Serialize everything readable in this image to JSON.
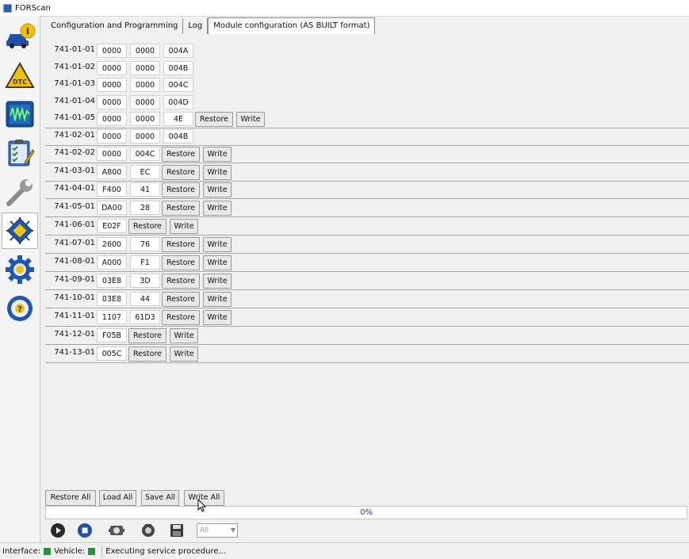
{
  "window": {
    "title": "FORScan"
  },
  "sidebar": {
    "items": [
      {
        "id": "vehicle-info",
        "icon": "car-info-icon"
      },
      {
        "id": "dtc",
        "icon": "dtc-warning-icon"
      },
      {
        "id": "oscilloscope",
        "icon": "oscilloscope-icon"
      },
      {
        "id": "tests",
        "icon": "checklist-icon"
      },
      {
        "id": "service",
        "icon": "wrench-icon"
      },
      {
        "id": "configuration",
        "icon": "chip-icon",
        "active": true
      },
      {
        "id": "settings",
        "icon": "gear-icon"
      },
      {
        "id": "help",
        "icon": "steering-help-icon"
      }
    ]
  },
  "tabs": [
    {
      "label": "Configuration and Programming"
    },
    {
      "label": "Log"
    },
    {
      "label": "Module configuration (AS BUILT format)",
      "active": true
    }
  ],
  "config": {
    "restore_label": "Restore",
    "write_label": "Write",
    "rows": [
      {
        "addr": "741-01-01",
        "cells": [
          "0000",
          "0000",
          "004A"
        ]
      },
      {
        "addr": "741-01-02",
        "cells": [
          "0000",
          "0000",
          "004B"
        ]
      },
      {
        "addr": "741-01-03",
        "cells": [
          "0000",
          "0000",
          "004C"
        ]
      },
      {
        "addr": "741-01-04",
        "cells": [
          "0000",
          "0000",
          "004D"
        ]
      },
      {
        "addr": "741-01-05",
        "cells": [
          "0000",
          "0000",
          "4E"
        ]
      },
      {
        "addr": "741-02-01",
        "cells": [
          "0000",
          "0000",
          "004B"
        ]
      },
      {
        "addr": "741-02-02",
        "cells": [
          "0000",
          "004C"
        ]
      },
      {
        "addr": "741-03-01",
        "cells": [
          "A800",
          "EC"
        ]
      },
      {
        "addr": "741-04-01",
        "cells": [
          "F400",
          "41"
        ]
      },
      {
        "addr": "741-05-01",
        "cells": [
          "DA00",
          "28"
        ]
      },
      {
        "addr": "741-06-01",
        "cells": [
          "E02F"
        ]
      },
      {
        "addr": "741-07-01",
        "cells": [
          "2600",
          "76"
        ]
      },
      {
        "addr": "741-08-01",
        "cells": [
          "A000",
          "F1"
        ]
      },
      {
        "addr": "741-09-01",
        "cells": [
          "03E8",
          "3D"
        ]
      },
      {
        "addr": "741-10-01",
        "cells": [
          "03E8",
          "44"
        ]
      },
      {
        "addr": "741-11-01",
        "cells": [
          "1107",
          "61D3"
        ]
      },
      {
        "addr": "741-12-01",
        "cells": [
          "F05B"
        ]
      },
      {
        "addr": "741-13-01",
        "cells": [
          "005C"
        ]
      }
    ]
  },
  "bottom_buttons": {
    "restore_all": "Restore All",
    "load_all": "Load All",
    "save_all": "Save All",
    "write_all": "Write All"
  },
  "progress": {
    "text": "0%",
    "value": 0
  },
  "toolbar": {
    "buttons": [
      "play-icon",
      "stop-icon",
      "module-icon",
      "scan-icon",
      "save-icon"
    ],
    "filter": {
      "value": "All"
    }
  },
  "status": {
    "interface_label": "Interface:",
    "vehicle_label": "Vehicle:",
    "message": "Executing service procedure...",
    "indicator_color": "#1a9b3b"
  }
}
